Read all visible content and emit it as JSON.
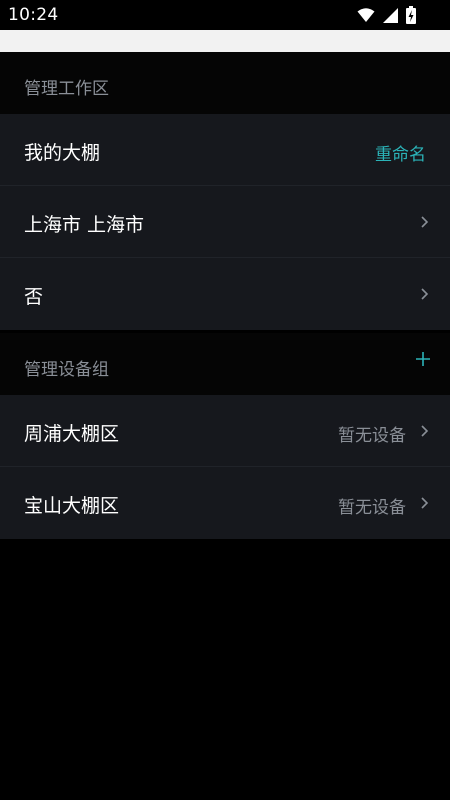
{
  "status_bar": {
    "time": "10:24"
  },
  "workspace_section": {
    "title": "管理工作区",
    "rows": [
      {
        "label": "我的大棚",
        "action": "重命名"
      },
      {
        "label": "上海市 上海市"
      },
      {
        "label": "否"
      }
    ]
  },
  "device_group_section": {
    "title": "管理设备组",
    "add_icon": "plus-icon",
    "rows": [
      {
        "label": "周浦大棚区",
        "value": "暂无设备"
      },
      {
        "label": "宝山大棚区",
        "value": "暂无设备"
      }
    ]
  },
  "colors": {
    "background": "#000000",
    "card": "#16181d",
    "accent": "#2bb3b8",
    "muted_text": "#8a8f97"
  }
}
